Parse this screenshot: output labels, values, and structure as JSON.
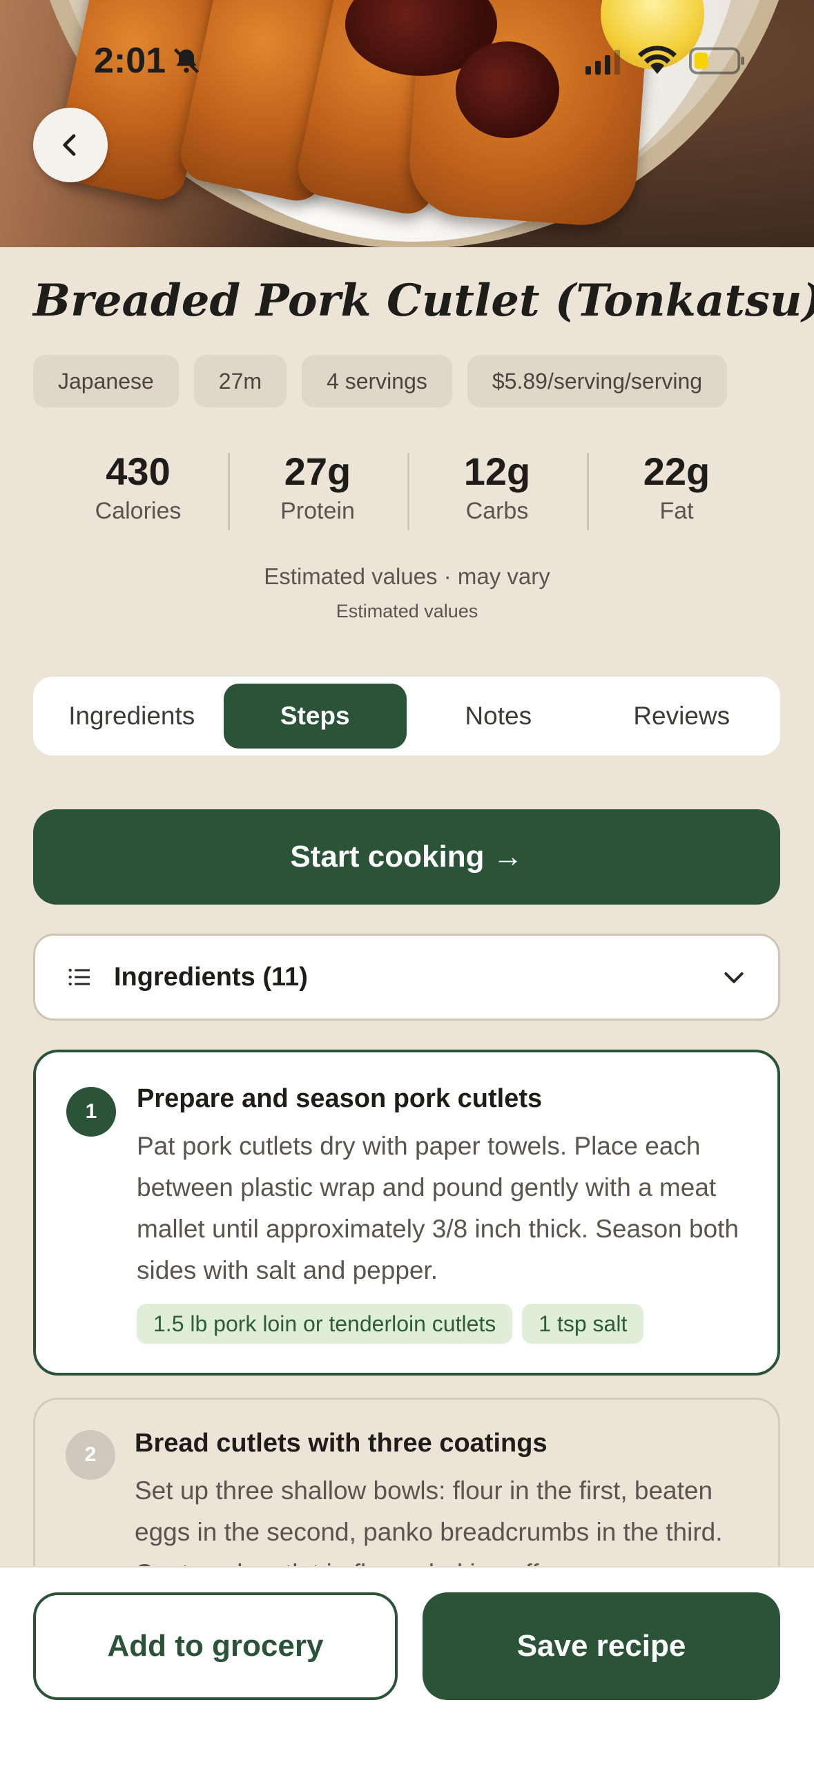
{
  "status_bar": {
    "time": "2:01"
  },
  "recipe": {
    "title": "Breaded Pork Cutlet (Tonkatsu)",
    "chips": [
      "Japanese",
      "27m",
      "4 servings",
      "$5.89/serving/serving"
    ]
  },
  "nutrition": [
    {
      "value": "430",
      "label": "Calories"
    },
    {
      "value": "27g",
      "label": "Protein"
    },
    {
      "value": "12g",
      "label": "Carbs"
    },
    {
      "value": "22g",
      "label": "Fat"
    }
  ],
  "estimate_note": "Estimated values · may vary",
  "estimate_sub": "Estimated values",
  "tabs": [
    {
      "label": "Ingredients",
      "active": false
    },
    {
      "label": "Steps",
      "active": true
    },
    {
      "label": "Notes",
      "active": false
    },
    {
      "label": "Reviews",
      "active": false
    }
  ],
  "start_cooking_label": "Start cooking →",
  "ingredients_toggle": {
    "label": "Ingredients (11)"
  },
  "steps": [
    {
      "number": "1",
      "title": "Prepare and season pork cutlets",
      "body": "Pat pork cutlets dry with paper towels. Place each between plastic wrap and pound gently with a meat mallet until approximately 3/8 inch thick. Season both sides with salt and pepper.",
      "tags": [
        "1.5 lb pork loin or tenderloin cutlets",
        "1 tsp salt"
      ]
    },
    {
      "number": "2",
      "title": "Bread cutlets with three coatings",
      "body": "Set up three shallow bowls: flour in the first, beaten eggs in the second, panko breadcrumbs in the third. Coat each cutlet in flour, shaking off excess."
    }
  ],
  "bottom": {
    "add_grocery_label": "Add to grocery",
    "save_recipe_label": "Save recipe"
  },
  "colors": {
    "brand_green": "#2a5338",
    "background": "#ede4d8",
    "chip_bg": "#e1d7c9",
    "tag_bg": "#deeed9"
  },
  "icons": {
    "back": "chevron-left-icon",
    "list": "list-icon",
    "expand": "chevron-down-icon",
    "silent": "bell-slash-icon"
  }
}
